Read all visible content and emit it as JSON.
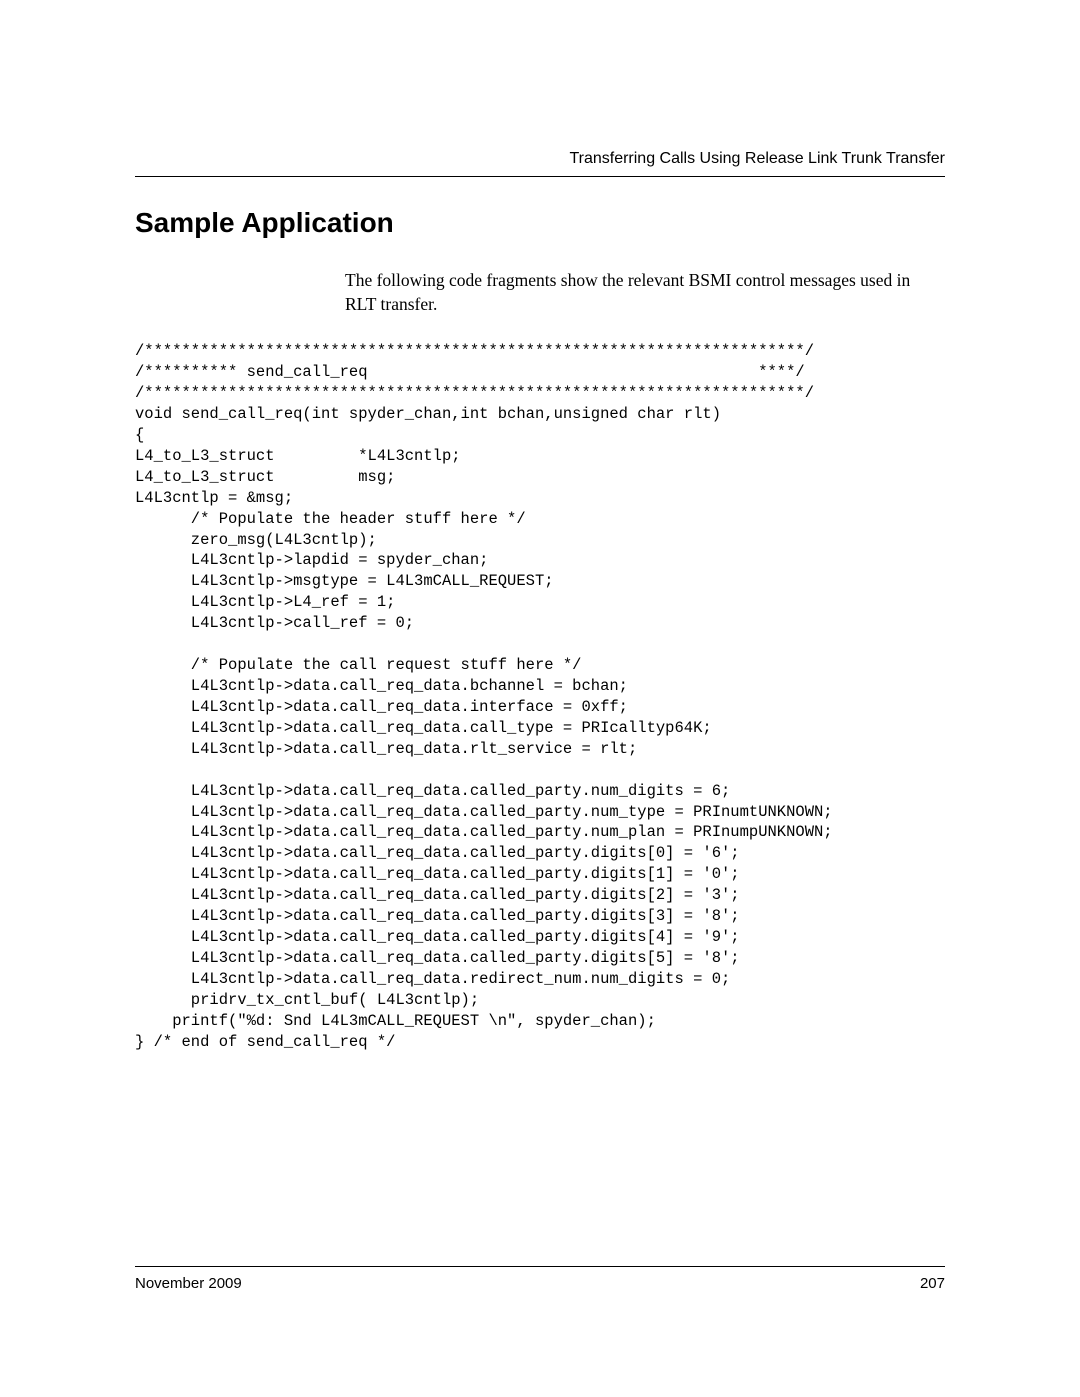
{
  "header": {
    "running_title": "Transferring Calls Using Release Link Trunk Transfer"
  },
  "section": {
    "title": "Sample Application",
    "intro": "The following code fragments show the relevant BSMI control messages used in RLT transfer."
  },
  "code": "/***********************************************************************/\n/********** send_call_req                                          ****/\n/***********************************************************************/\nvoid send_call_req(int spyder_chan,int bchan,unsigned char rlt)\n{\nL4_to_L3_struct         *L4L3cntlp;\nL4_to_L3_struct         msg;\nL4L3cntlp = &msg;\n      /* Populate the header stuff here */\n      zero_msg(L4L3cntlp);\n      L4L3cntlp->lapdid = spyder_chan;\n      L4L3cntlp->msgtype = L4L3mCALL_REQUEST;\n      L4L3cntlp->L4_ref = 1;\n      L4L3cntlp->call_ref = 0;\n\n      /* Populate the call request stuff here */\n      L4L3cntlp->data.call_req_data.bchannel = bchan;\n      L4L3cntlp->data.call_req_data.interface = 0xff;\n      L4L3cntlp->data.call_req_data.call_type = PRIcalltyp64K;\n      L4L3cntlp->data.call_req_data.rlt_service = rlt;\n\n      L4L3cntlp->data.call_req_data.called_party.num_digits = 6;\n      L4L3cntlp->data.call_req_data.called_party.num_type = PRInumtUNKNOWN;\n      L4L3cntlp->data.call_req_data.called_party.num_plan = PRInumpUNKNOWN;\n      L4L3cntlp->data.call_req_data.called_party.digits[0] = '6';\n      L4L3cntlp->data.call_req_data.called_party.digits[1] = '0';\n      L4L3cntlp->data.call_req_data.called_party.digits[2] = '3';\n      L4L3cntlp->data.call_req_data.called_party.digits[3] = '8';\n      L4L3cntlp->data.call_req_data.called_party.digits[4] = '9';\n      L4L3cntlp->data.call_req_data.called_party.digits[5] = '8';\n      L4L3cntlp->data.call_req_data.redirect_num.num_digits = 0;\n      pridrv_tx_cntl_buf( L4L3cntlp);\n    printf(\"%d: Snd L4L3mCALL_REQUEST \\n\", spyder_chan);\n} /* end of send_call_req */",
  "footer": {
    "date": "November 2009",
    "page": "207"
  }
}
